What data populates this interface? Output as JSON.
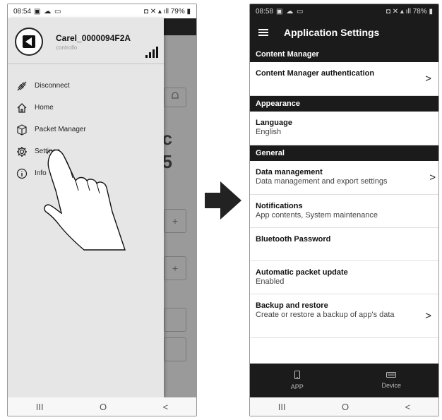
{
  "left": {
    "status_time": "08:54",
    "status_right": "79%",
    "device_name": "Carel_0000094F2A",
    "device_sub": "controllo",
    "menu": [
      {
        "label": "Disconnect",
        "icon": "disconnect-icon"
      },
      {
        "label": "Home",
        "icon": "home-icon"
      },
      {
        "label": "Packet Manager",
        "icon": "package-icon"
      },
      {
        "label": "Settings",
        "icon": "gear-icon"
      },
      {
        "label": "Info",
        "icon": "info-icon"
      }
    ],
    "bg_glyphs": {
      "c": "c",
      "five": "5",
      "plus": "+"
    }
  },
  "right": {
    "status_time": "08:58",
    "status_right": "78%",
    "title": "Application Settings",
    "sections": {
      "content_manager": "Content Manager",
      "appearance": "Appearance",
      "general": "General"
    },
    "rows": {
      "cm_auth": {
        "title": "Content Manager authentication"
      },
      "language": {
        "title": "Language",
        "sub": "English"
      },
      "data_mgmt": {
        "title": "Data management",
        "sub": "Data management and export settings"
      },
      "notifications": {
        "title": "Notifications",
        "sub": "App contents, System maintenance"
      },
      "bt_password": {
        "title": "Bluetooth Password"
      },
      "auto_update": {
        "title": "Automatic packet update",
        "sub": "Enabled"
      },
      "backup": {
        "title": "Backup and restore",
        "sub": "Create or restore a backup of app's data"
      }
    },
    "bottom_tabs": [
      {
        "label": "APP",
        "icon": "phone-icon"
      },
      {
        "label": "Device",
        "icon": "device-icon"
      }
    ]
  },
  "nav": {
    "recent": "III",
    "home": "O",
    "back": "<"
  },
  "colors": {
    "dark": "#1b1b1b",
    "drawer": "#e6e6e6",
    "scrim": "#9a9a9a"
  }
}
